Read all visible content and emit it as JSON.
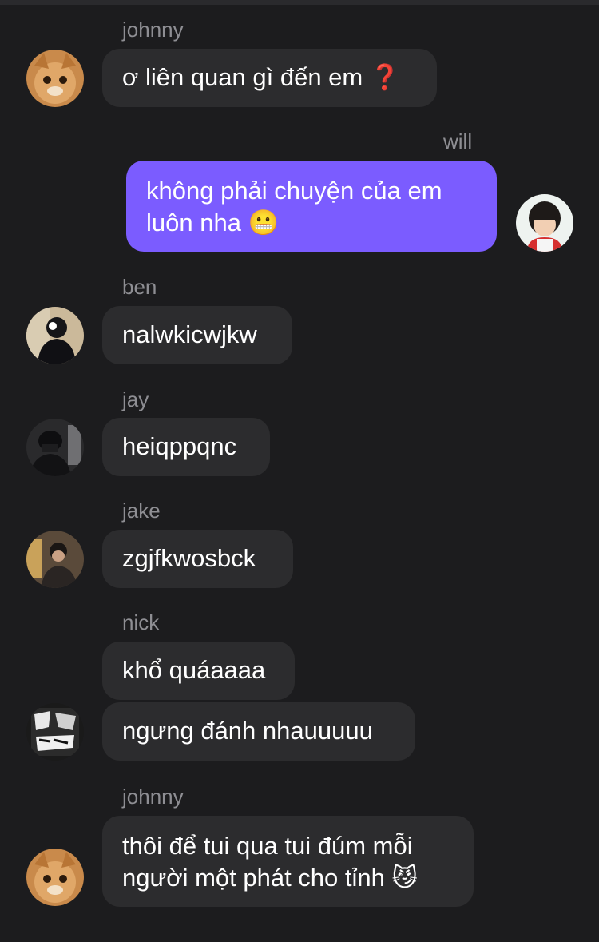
{
  "messages": [
    {
      "sender": "johnny",
      "lines": [
        "ơ liên quan gì đến em ❓"
      ]
    },
    {
      "sender": "will",
      "lines": [
        "không phải chuyện của em",
        "luôn nha 😬"
      ]
    },
    {
      "sender": "ben",
      "lines": [
        "nalwkicwjkw"
      ]
    },
    {
      "sender": "jay",
      "lines": [
        "heiqppqnc"
      ]
    },
    {
      "sender": "jake",
      "lines": [
        "zgjfkwosbck"
      ]
    },
    {
      "sender": "nick",
      "lines": [
        "khổ quáaaaa"
      ]
    },
    {
      "sender": "nick",
      "lines": [
        "ngưng đánh nhauuuuu"
      ]
    },
    {
      "sender": "johnny",
      "lines": [
        "thôi để tui qua tui đúm mỗi",
        "người một phát cho tỉnh 😼"
      ]
    }
  ],
  "colors": {
    "background": "#1c1c1e",
    "bubble": "#2c2c2e",
    "own_bubble": "#7b5cff",
    "name": "#8e8e93"
  },
  "avatars": {
    "johnny": "cat-avatar",
    "will": "child-avatar",
    "ben": "person-avatar",
    "jay": "person-avatar",
    "jake": "person-avatar",
    "nick": "graffiti-avatar"
  }
}
